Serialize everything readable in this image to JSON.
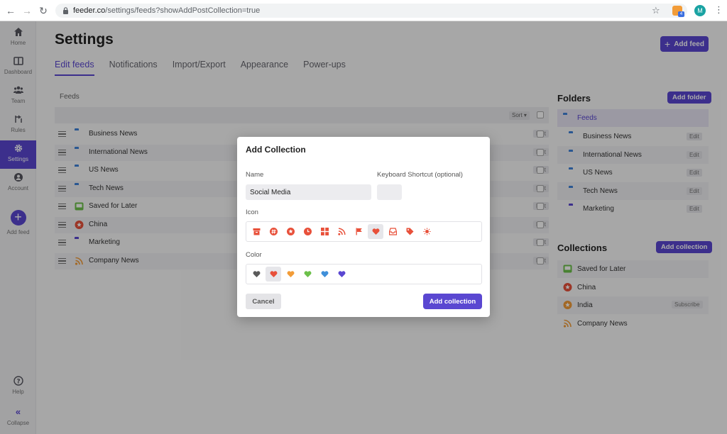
{
  "browser": {
    "url_host": "feeder.co",
    "url_path": "/settings/feeds?showAddPostCollection=true",
    "ext_badge": "4",
    "profile_initial": "M"
  },
  "sidebar": {
    "items": [
      {
        "label": "Home",
        "icon": "home-icon"
      },
      {
        "label": "Dashboard",
        "icon": "dashboard-icon"
      },
      {
        "label": "Team",
        "icon": "team-icon"
      },
      {
        "label": "Rules",
        "icon": "rules-icon"
      },
      {
        "label": "Settings",
        "icon": "gear-icon",
        "active": true
      },
      {
        "label": "Account",
        "icon": "account-icon"
      }
    ],
    "add_feed_label": "Add feed",
    "help_label": "Help",
    "collapse_label": "Collapse"
  },
  "header": {
    "title": "Settings",
    "add_feed_button": "Add feed",
    "tabs": [
      "Edit feeds",
      "Notifications",
      "Import/Export",
      "Appearance",
      "Power-ups"
    ],
    "active_tab": "Edit feeds"
  },
  "feeds": {
    "label": "Feeds",
    "sort_label": "Sort",
    "edit_label": "Edit",
    "rows": [
      {
        "name": "Business News",
        "icon": "folder-icon"
      },
      {
        "name": "International News",
        "icon": "folder-icon"
      },
      {
        "name": "US News",
        "icon": "folder-icon"
      },
      {
        "name": "Tech News",
        "icon": "folder-icon"
      },
      {
        "name": "Saved for Later",
        "icon": "inbox-icon"
      },
      {
        "name": "China",
        "icon": "star-icon"
      },
      {
        "name": "Marketing",
        "icon": "folder-icon"
      },
      {
        "name": "Company News",
        "icon": "rss-icon"
      }
    ]
  },
  "folders": {
    "title": "Folders",
    "add_button": "Add folder",
    "root": "Feeds",
    "edit_label": "Edit",
    "items": [
      "Business News",
      "International News",
      "US News",
      "Tech News",
      "Marketing"
    ]
  },
  "collections": {
    "title": "Collections",
    "add_button": "Add collection",
    "subscribe_label": "Subscribe",
    "items": [
      "Saved for Later",
      "China",
      "India",
      "Company News"
    ]
  },
  "modal": {
    "title": "Add Collection",
    "name_label": "Name",
    "name_value": "Social Media",
    "shortcut_label": "Keyboard Shortcut (optional)",
    "shortcut_value": "",
    "icon_label": "Icon",
    "icons": [
      "archive-icon",
      "hashtag-icon",
      "star-icon",
      "clock-icon",
      "grid-icon",
      "rss-icon",
      "flag-icon",
      "heart-icon",
      "inbox-icon",
      "tag-icon",
      "lightbulb-icon"
    ],
    "selected_icon": "heart-icon",
    "color_label": "Color",
    "colors": [
      "#5a5a5a",
      "#e8503a",
      "#f29c38",
      "#6cc04a",
      "#3f8fd9",
      "#5a47d1"
    ],
    "selected_color": "#e8503a",
    "cancel_button": "Cancel",
    "submit_button": "Add collection"
  },
  "theme": {
    "accent": "#5a47d1",
    "icon_red": "#e8503a"
  }
}
